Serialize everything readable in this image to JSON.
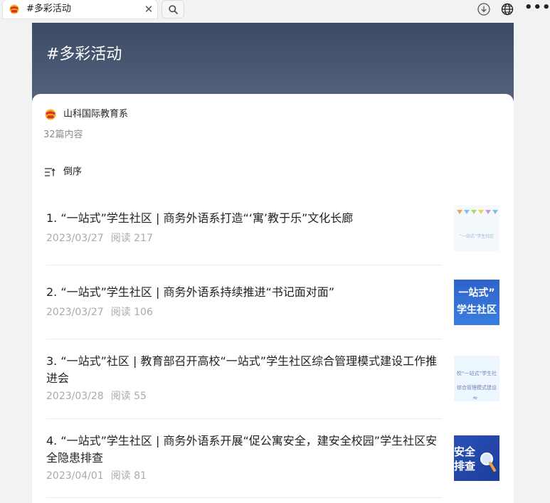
{
  "browser": {
    "tab_title": "#多彩活动",
    "tab_close": "✕",
    "icons": [
      "search-icon",
      "download-icon",
      "globe-icon",
      "more-icon"
    ]
  },
  "hero": {
    "title": "#多彩活动"
  },
  "account": {
    "name": "山科国际教育系",
    "count": "32篇内容"
  },
  "sort": {
    "label": "倒序"
  },
  "articles": [
    {
      "title": "1. “一站式”学生社区 | 商务外语系打造“‘寓’教于乐”文化长廊",
      "date": "2023/03/27",
      "reads": "阅读 217",
      "thumb_text": "“一站式”学生社区"
    },
    {
      "title": "2. “一站式”学生社区 | 商务外语系持续推进“书记面对面”",
      "date": "2023/03/27",
      "reads": "阅读 106",
      "thumb_text": [
        "一站式”",
        "学生社区"
      ]
    },
    {
      "title": "3. “一站式”社区 | 教育部召开高校“一站式”学生社区综合管理模式建设工作推进会",
      "date": "2023/03/28",
      "reads": "阅读 55",
      "thumb_text": [
        "校“一站式”学生社",
        "综合管理模式建设"
      ]
    },
    {
      "title": "4. “一站式”学生社区 | 商务外语系开展“促公寓安全，建安全校园”学生社区安全隐患排查",
      "date": "2023/04/01",
      "reads": "阅读 81",
      "thumb_text": [
        "安全",
        "排查"
      ]
    }
  ],
  "colors": {
    "hero_top": "#3d4a63",
    "hero_bottom": "#566481",
    "meta_gray": "#aaaaaa",
    "logo_red": "#d9302c",
    "logo_gold": "#f4b21d"
  }
}
